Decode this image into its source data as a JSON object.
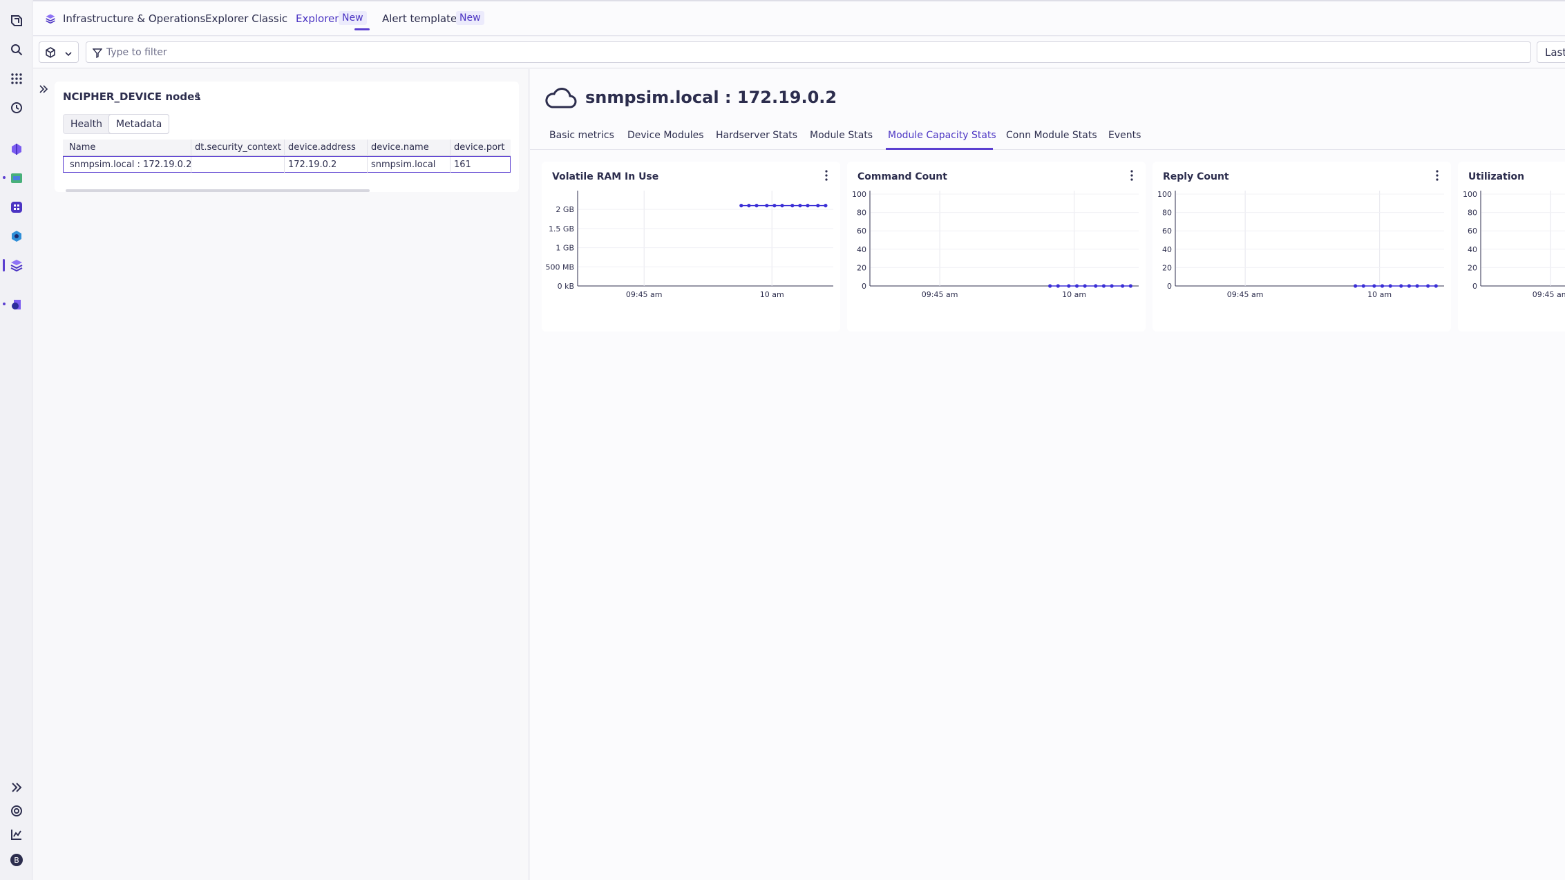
{
  "topbar": {
    "app_name": "Infrastructure & Operations",
    "tabs": [
      {
        "label": "Explorer Classic"
      },
      {
        "label": "Explorer",
        "badge": "New"
      },
      {
        "label": "Alert templates",
        "badge": "New"
      }
    ]
  },
  "filter": {
    "placeholder": "Type to filter",
    "timeframe_label": "Last"
  },
  "left": {
    "title": "NCIPHER_DEVICE nodes",
    "count": "1",
    "tabs": [
      "Health",
      "Metadata"
    ],
    "columns": [
      "Name",
      "dt.security_context",
      "device.address",
      "device.name",
      "device.port"
    ],
    "rows": [
      [
        "snmpsim.local : 172.19.0.2",
        "",
        "172.19.0.2",
        "snmpsim.local",
        "161"
      ]
    ]
  },
  "right": {
    "title": "snmpsim.local : 172.19.0.2",
    "tabs": [
      "Basic metrics",
      "Device Modules",
      "Hardserver Stats",
      "Module Stats",
      "Module Capacity Stats",
      "Conn Module Stats",
      "Events"
    ],
    "active_tab": "Module Capacity Stats"
  },
  "colors": {
    "accent": "#5b3fd0",
    "series": "#3b2fd6"
  },
  "chart_data": [
    {
      "type": "line",
      "title": "Volatile RAM In Use",
      "ytick_labels": [
        "0 kB",
        "500 MB",
        "1 GB",
        "1.5 GB",
        "2 GB"
      ],
      "xtick_labels": [
        "09:45 am",
        "10 am"
      ],
      "ylim": [
        0,
        2.4
      ],
      "series": [
        {
          "x": [
            0.64,
            0.67,
            0.7,
            0.74,
            0.77,
            0.8,
            0.84,
            0.87,
            0.9,
            0.94,
            0.97
          ],
          "values": [
            2.1,
            2.1,
            2.1,
            2.1,
            2.1,
            2.1,
            2.1,
            2.1,
            2.1,
            2.1,
            2.1
          ]
        }
      ]
    },
    {
      "type": "line",
      "title": "Command Count",
      "ytick_labels": [
        "0",
        "20",
        "40",
        "60",
        "80",
        "100"
      ],
      "xtick_labels": [
        "09:45 am",
        "10 am"
      ],
      "ylim": [
        0,
        100
      ],
      "series": [
        {
          "x": [
            0.67,
            0.7,
            0.74,
            0.77,
            0.8,
            0.84,
            0.87,
            0.9,
            0.94,
            0.97
          ],
          "values": [
            0,
            0,
            0,
            0,
            0,
            0,
            0,
            0,
            0,
            0
          ]
        }
      ]
    },
    {
      "type": "line",
      "title": "Reply Count",
      "ytick_labels": [
        "0",
        "20",
        "40",
        "60",
        "80",
        "100"
      ],
      "xtick_labels": [
        "09:45 am",
        "10 am"
      ],
      "ylim": [
        0,
        100
      ],
      "series": [
        {
          "x": [
            0.67,
            0.7,
            0.74,
            0.77,
            0.8,
            0.84,
            0.87,
            0.9,
            0.94,
            0.97
          ],
          "values": [
            0,
            0,
            0,
            0,
            0,
            0,
            0,
            0,
            0,
            0
          ]
        }
      ]
    },
    {
      "type": "line",
      "title": "Utilization",
      "ytick_labels": [
        "0",
        "20",
        "40",
        "60",
        "80",
        "100"
      ],
      "xtick_labels": [
        "09:45 am"
      ],
      "ylim": [
        0,
        100
      ],
      "series": []
    }
  ]
}
